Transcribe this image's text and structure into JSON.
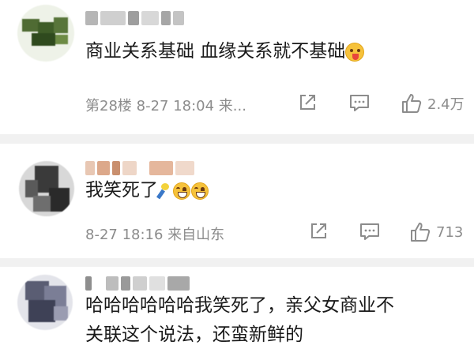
{
  "comments": [
    {
      "text": "商业关系基础 血缘关系就不基础",
      "meta": "第28楼 8-27 18:04 来...",
      "likes": "2.4万",
      "emojis": [
        "tongue-out-emoji"
      ]
    },
    {
      "text": "我笑死了",
      "meta": "8-27 18:16 来自山东",
      "likes": "713",
      "emojis": [
        "bottle-emoji",
        "laugh-cry-emoji",
        "laugh-cry-emoji"
      ]
    },
    {
      "text_line1": "哈哈哈哈哈哈我笑死了，亲父女商业不",
      "text_line2": "关联这个说法，还蛮新鲜的"
    }
  ],
  "icons": {
    "share": "share-icon",
    "comment": "comment-icon",
    "like": "thumbs-up-icon"
  },
  "colors": {
    "text": "#1a1a1a",
    "meta": "#8c8c8c",
    "separator": "#f1f1f1"
  }
}
